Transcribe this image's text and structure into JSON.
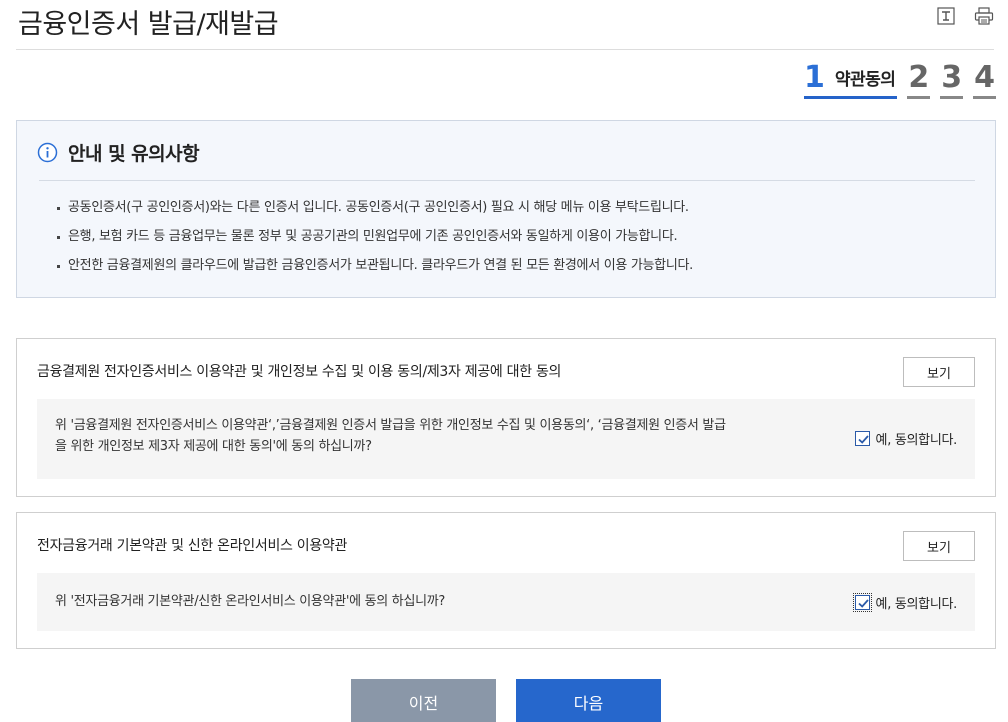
{
  "page": {
    "title": "금융인증서 발급/재발급"
  },
  "tools": {
    "font_size_icon": "font-size-icon",
    "print_icon": "print-icon"
  },
  "steps": {
    "active_number": "1",
    "active_label": "약관동의",
    "others": [
      "2",
      "3",
      "4"
    ]
  },
  "notice": {
    "title": "안내 및 유의사항",
    "items": [
      "공동인증서(구 공인인증서)와는 다른 인증서 입니다. 공동인증서(구 공인인증서) 필요 시 해당 메뉴 이용 부탁드립니다.",
      "은행, 보험 카드 등 금융업무는 물론 정부 및 공공기관의 민원업무에 기존 공인인증서와 동일하게 이용이 가능합니다.",
      "안전한 금융결제원의 클라우드에 발급한 금융인증서가 보관됩니다. 클라우드가 연결 된 모든 환경에서 이용 가능합니다."
    ]
  },
  "agreements": [
    {
      "title": "금융결제원 전자인증서비스 이용약관 및 개인정보 수집 및 이용 동의/제3자 제공에 대한 동의",
      "view_label": "보기",
      "question_line1": "위 '금융결제원 전자인증서비스 이용약관‘,’금융결제원 인증서 발급을 위한 개인정보 수집 및 이용동의‘, ‘금융결제원 인증서 발급",
      "question_line2": "을 위한 개인정보 제3자 제공에 대한 동의'에 동의 하십니까?",
      "check_label": "예, 동의합니다.",
      "checked": true
    },
    {
      "title": "전자금융거래 기본약관 및 신한 온라인서비스 이용약관",
      "view_label": "보기",
      "question_line1": "위 '전자금융거래 기본약관/신한 온라인서비스 이용약관'에 동의 하십니까?",
      "check_label": "예, 동의합니다.",
      "checked": true
    }
  ],
  "buttons": {
    "prev": "이전",
    "next": "다음"
  },
  "colors": {
    "accent": "#2667cc",
    "step_active": "#2b6fd6",
    "prev_button": "#8a97a8",
    "notice_bg": "#f4f7fc"
  }
}
